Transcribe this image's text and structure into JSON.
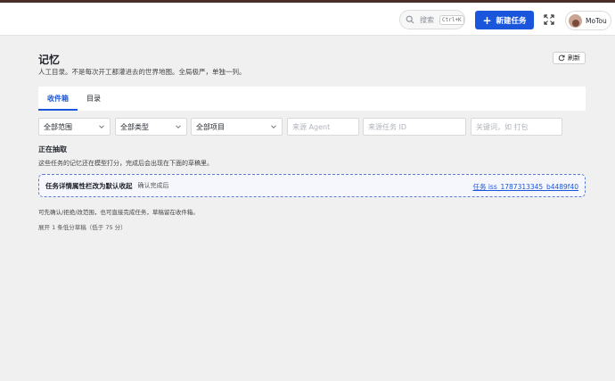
{
  "topbar": {
    "search_label": "搜索",
    "search_shortcut": "Ctrl+K",
    "new_task_label": "新建任务",
    "user_name": "MoTou"
  },
  "header": {
    "title": "记忆",
    "subtitle": "人工目录。不是每次开工都灌进去的世界地图。全局极严，单独一列。",
    "refresh_label": "刷新"
  },
  "tabs": [
    {
      "label": "收件箱",
      "active": true
    },
    {
      "label": "目录",
      "active": false
    }
  ],
  "filters": {
    "scope": "全部范围",
    "type": "全部类型",
    "project": "全部项目",
    "agent_placeholder": "来源 Agent",
    "task_id_placeholder": "来源任务 ID",
    "keyword_placeholder": "关键词，如 打包"
  },
  "section": {
    "title": "正在抽取",
    "description": "这些任务的记忆还在模型打分，完成后会出现在下面的草稿里。"
  },
  "extracting_items": [
    {
      "title": "任务详情属性栏改为默认收起",
      "status": "确认完成后",
      "task_link": "任务 iss_1787313345_b4489f40"
    }
  ],
  "footer": {
    "note": "可先确认/拒绝/改范围，也可直接完成任务，草稿留在收件箱。",
    "expand_low": "展开 1 条低分草稿（低于 75 分）"
  },
  "colors": {
    "accent": "#1a56db",
    "top_strip": "#4a2f28"
  }
}
